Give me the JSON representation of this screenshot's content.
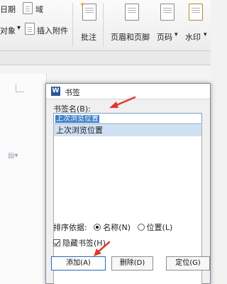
{
  "ribbon": {
    "date_label": "日期",
    "domain_label": "域",
    "object_label": "对象",
    "insert_attachment_label": "插入附件",
    "annotation_label": "批注",
    "header_footer_label": "页眉和页脚",
    "page_number_label": "页码",
    "watermark_label": "水印"
  },
  "dialog": {
    "title": "书签",
    "logo_letter": "W",
    "name_label": "书签名(B):",
    "name_value": "上次浏览位置",
    "list_items": [
      "上次浏览位置"
    ],
    "sort_label": "排序依据:",
    "sort_by_name_label": "名称(N)",
    "sort_by_position_label": "位置(L)",
    "sort_selected": "name",
    "hidden_bookmarks_label": "隐藏书签(H)",
    "hidden_bookmarks_checked": true,
    "add_button": "添加(A)",
    "delete_button": "删除(D)",
    "locate_button": "定位(G)"
  },
  "colors": {
    "arrow": "#e0392e",
    "selection": "#3c7fc9",
    "primary_border": "#2a69b7"
  }
}
